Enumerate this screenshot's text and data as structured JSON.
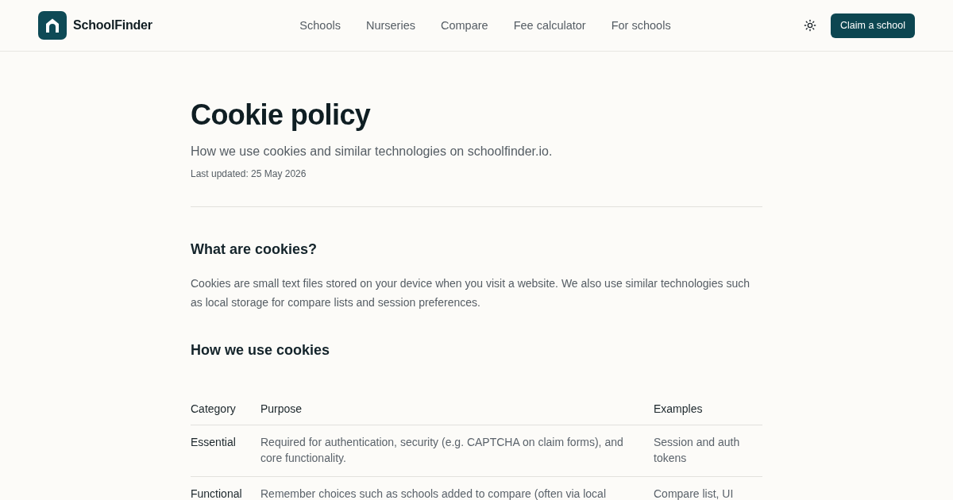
{
  "header": {
    "brand": "SchoolFinder",
    "nav": [
      "Schools",
      "Nurseries",
      "Compare",
      "Fee calculator",
      "For schools"
    ],
    "cta": "Claim a school"
  },
  "page": {
    "title": "Cookie policy",
    "subtitle": "How we use cookies and similar technologies on schoolfinder.io.",
    "last_updated": "Last updated: 25 May 2026"
  },
  "sections": [
    {
      "kind": "text",
      "heading": "What are cookies?",
      "body": "Cookies are small text files stored on your device when you visit a website. We also use similar technologies such as local storage for compare lists and session preferences."
    },
    {
      "kind": "table",
      "heading": "How we use cookies",
      "table": {
        "columns": [
          "Category",
          "Purpose",
          "Examples"
        ],
        "rows": [
          [
            "Essential",
            "Required for authentication, security (e.g. CAPTCHA on claim forms), and core functionality.",
            "Session and auth tokens"
          ],
          [
            "Functional",
            "Remember choices such as schools added to compare (often via local",
            "Compare list, UI"
          ]
        ]
      }
    }
  ]
}
